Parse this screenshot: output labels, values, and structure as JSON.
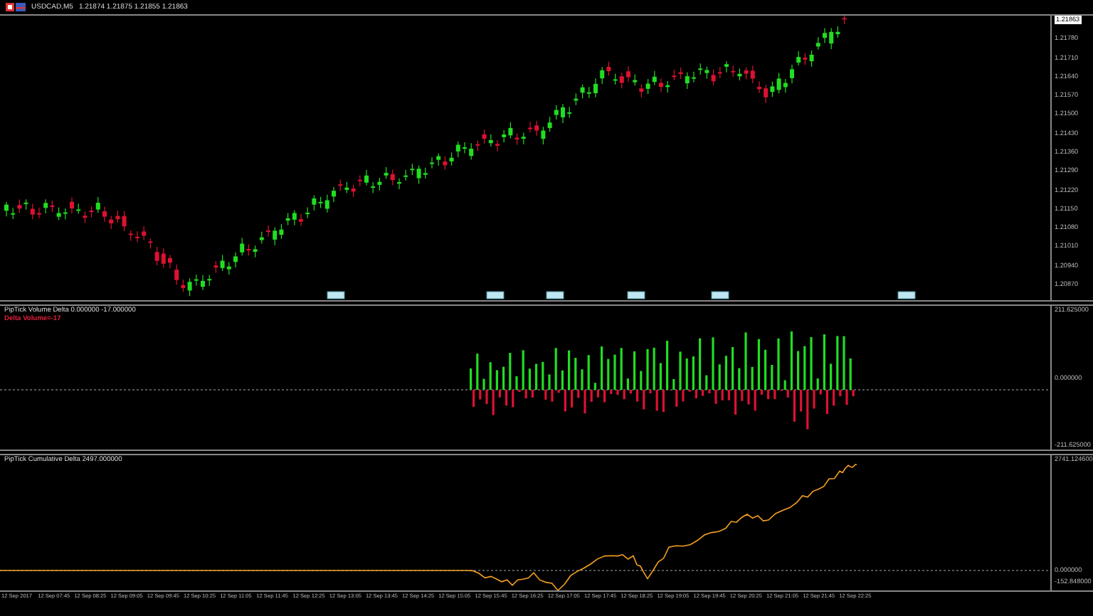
{
  "header": {
    "symbol": "USDCAD,M5",
    "quote": "1.21874 1.21875 1.21855 1.21863"
  },
  "main_chart": {
    "current_price": "1.21863",
    "price_axis": [
      "1.21780",
      "1.21710",
      "1.21640",
      "1.21570",
      "1.21500",
      "1.21430",
      "1.21360",
      "1.21290",
      "1.21220",
      "1.21150",
      "1.21080",
      "1.21010",
      "1.20940",
      "1.20870"
    ]
  },
  "volume_delta": {
    "title": "PipTick Volume Delta 0.000000 -17.000000",
    "value_label": "Delta Volume=-17",
    "axis": [
      "211.625000",
      "0.000000",
      "-211.625000"
    ]
  },
  "cumulative_delta": {
    "title": "PipTick Cumulative Delta 2497.000000",
    "axis": [
      "2741.124600",
      "0.000000",
      "-152.848000"
    ]
  },
  "time_axis": [
    "12 Sep 2017",
    "12 Sep 07:45",
    "12 Sep 08:25",
    "12 Sep 09:05",
    "12 Sep 09:45",
    "12 Sep 10:25",
    "12 Sep 11:05",
    "12 Sep 11:45",
    "12 Sep 12:25",
    "12 Sep 13:05",
    "12 Sep 13:45",
    "12 Sep 14:25",
    "12 Sep 15:05",
    "12 Sep 15:45",
    "12 Sep 16:25",
    "12 Sep 17:05",
    "12 Sep 17:45",
    "12 Sep 18:25",
    "12 Sep 19:05",
    "12 Sep 19:45",
    "12 Sep 20:25",
    "12 Sep 21:05",
    "12 Sep 21:45",
    "12 Sep 22:25"
  ]
}
